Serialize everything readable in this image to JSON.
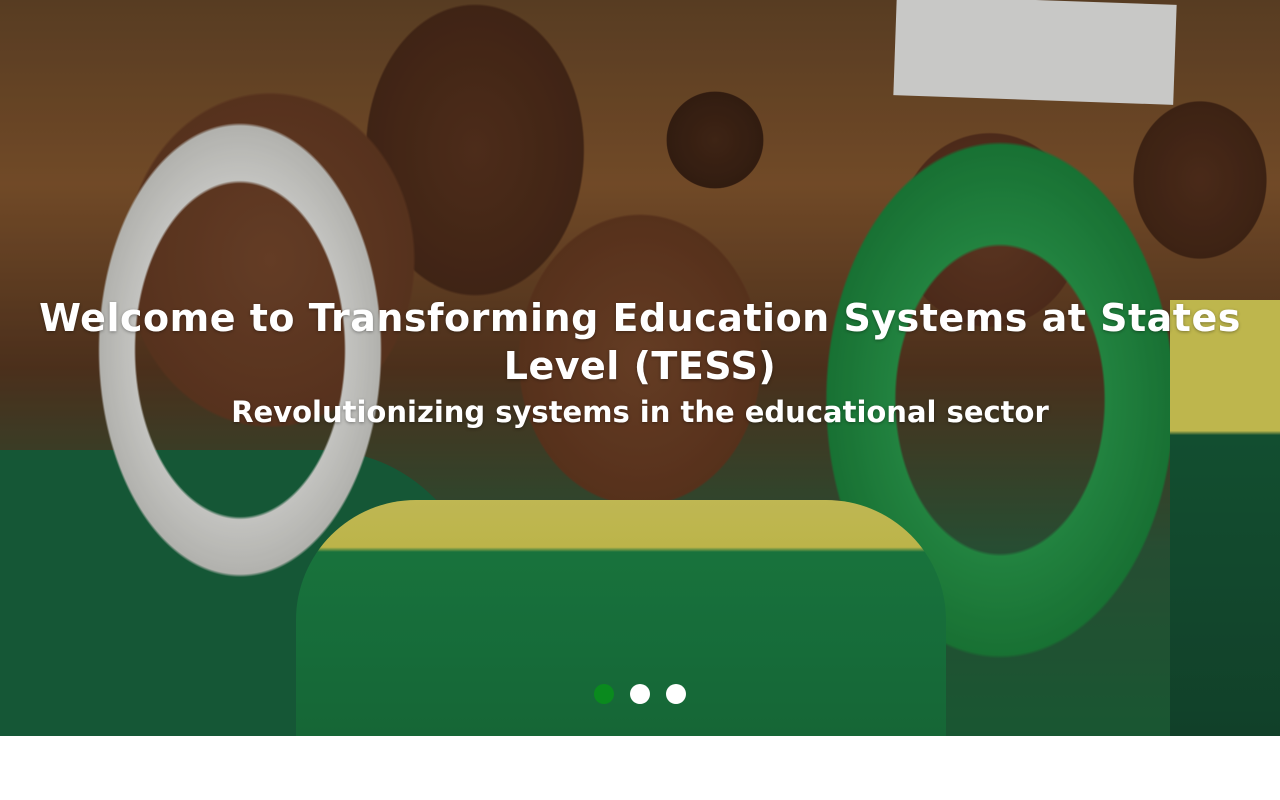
{
  "hero": {
    "title": "Welcome to Transforming Education Systems at States Level (TESS)",
    "subtitle": "Revolutionizing systems in the educational sector",
    "image_description_icon": "hero-photo-children-in-school-uniforms"
  },
  "carousel": {
    "slide_count": 3,
    "active_index": 0,
    "active_color": "#0a8a1e",
    "inactive_color": "#ffffff"
  }
}
